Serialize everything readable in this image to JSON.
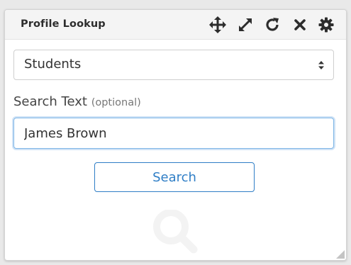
{
  "widget": {
    "title": "Profile Lookup",
    "header_icons": [
      "move-icon",
      "expand-icon",
      "refresh-icon",
      "close-icon",
      "gear-icon"
    ]
  },
  "form": {
    "category_select": {
      "selected": "Students"
    },
    "search_label": "Search Text",
    "search_label_optional": "(optional)",
    "search_input": {
      "value": "James Brown"
    },
    "search_button_label": "Search"
  },
  "colors": {
    "accent": "#2f7ec6",
    "focus_border": "#7fb6e6",
    "header_bg": "#f4f4f4",
    "icon_dark": "#2d2d2d"
  }
}
